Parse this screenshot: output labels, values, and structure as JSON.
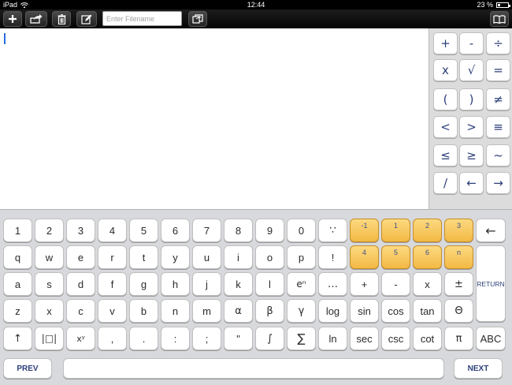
{
  "status_bar": {
    "device": "iPad",
    "time": "12:44",
    "battery_text": "23 %",
    "battery_level": 0.23
  },
  "toolbar": {
    "filename_placeholder": "Enter Filename",
    "buttons": [
      "add-icon",
      "share-icon",
      "trash-icon",
      "edit-icon",
      "open-folder-icon",
      "book-icon"
    ]
  },
  "side_keys": [
    [
      "+",
      "-",
      "÷"
    ],
    [
      "x",
      "√",
      "="
    ],
    [
      "(",
      ")",
      "≠"
    ],
    [
      "<",
      ">",
      "≡"
    ],
    [
      "≤",
      "≥",
      "~"
    ],
    [
      "/",
      "←",
      "→"
    ]
  ],
  "keyboard": {
    "row1": [
      "1",
      "2",
      "3",
      "4",
      "5",
      "6",
      "7",
      "8",
      "9",
      "0",
      "∵",
      "-1",
      "1",
      "2",
      "3",
      "←"
    ],
    "row2": [
      "q",
      "w",
      "e",
      "r",
      "t",
      "y",
      "u",
      "i",
      "o",
      "p",
      "!",
      "4",
      "5",
      "6",
      "n"
    ],
    "row3": [
      "a",
      "s",
      "d",
      "f",
      "g",
      "h",
      "j",
      "k",
      "l",
      "eⁿ",
      "…",
      "+",
      "-",
      "x",
      "±"
    ],
    "row4": [
      "z",
      "x",
      "c",
      "v",
      "b",
      "n",
      "m",
      "α",
      "β",
      "γ",
      "log",
      "sin",
      "cos",
      "tan",
      "Θ"
    ],
    "row5": [
      "↑",
      "|□|",
      "xʸ",
      ",",
      ".",
      ":",
      ";",
      "\"",
      "∫",
      "∑",
      "ln",
      "sec",
      "csc",
      "cot",
      "π",
      "ABC"
    ],
    "return_label": "RETURN",
    "prev_label": "PREV",
    "next_label": "NEXT"
  },
  "colors": {
    "accent_orange": "#f3b945",
    "key_text_blue": "#2d3f7a",
    "caret": "#2a6ce0"
  }
}
